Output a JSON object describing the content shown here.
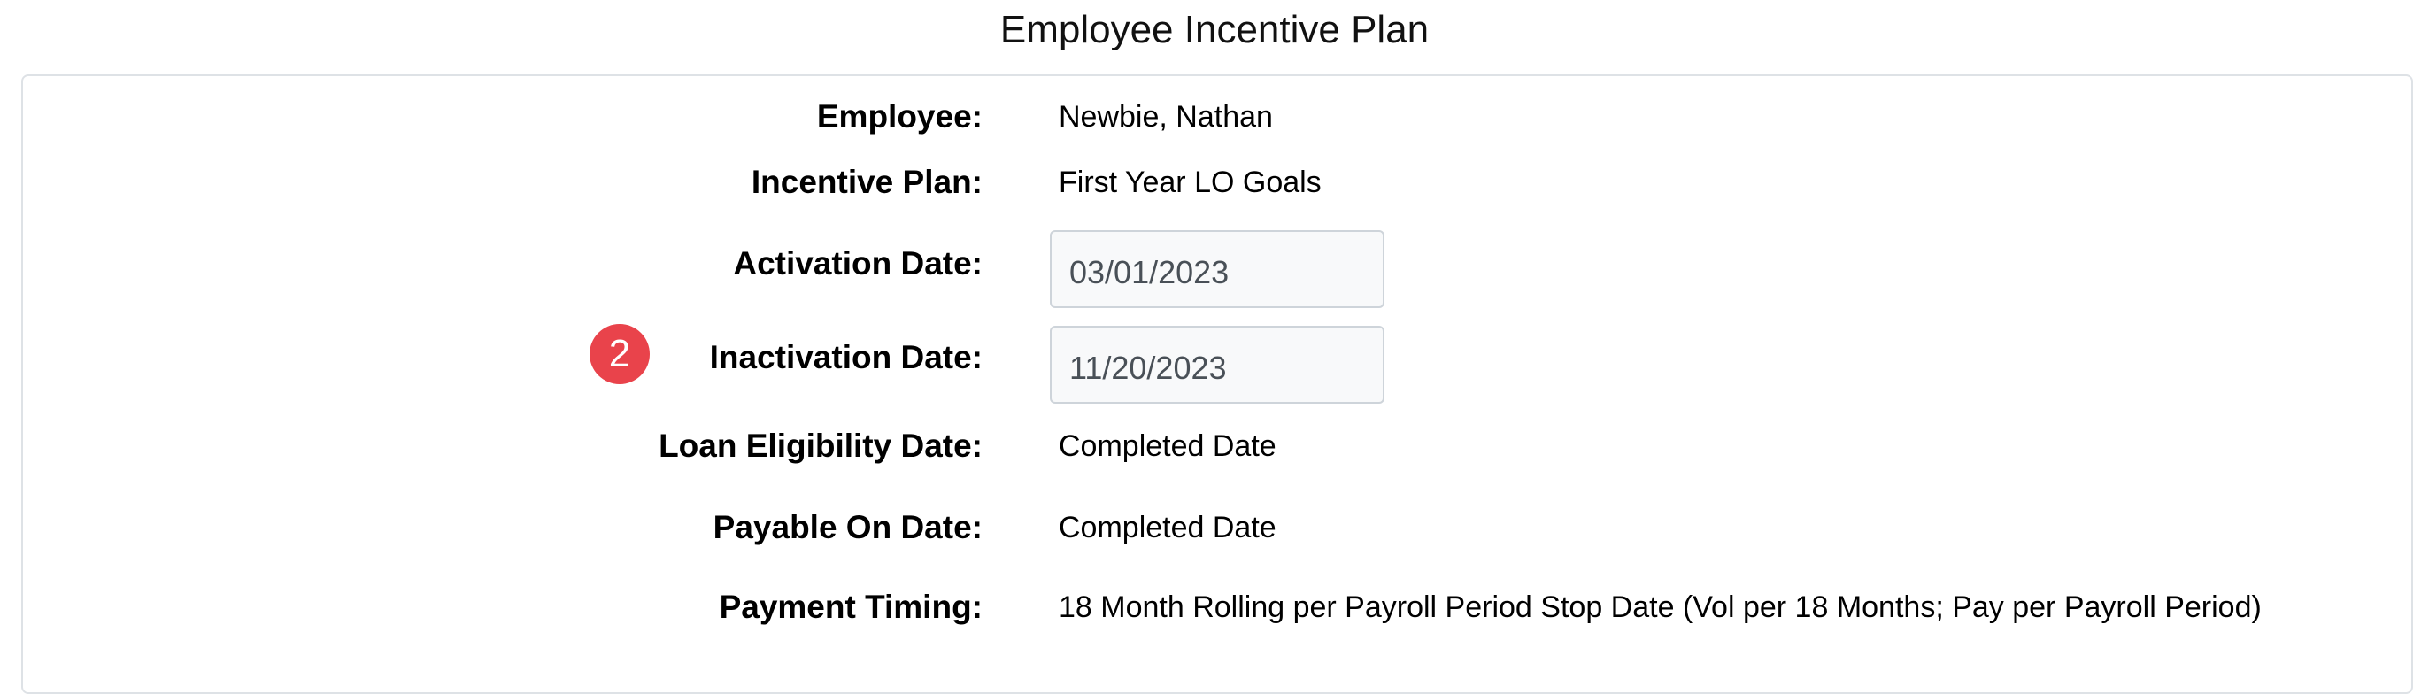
{
  "page": {
    "title": "Employee Incentive Plan"
  },
  "form": {
    "employee": {
      "label": "Employee:",
      "value": "Newbie, Nathan"
    },
    "incentive_plan": {
      "label": "Incentive Plan:",
      "value": "First Year LO Goals"
    },
    "activation_date": {
      "label": "Activation Date:",
      "value": "03/01/2023"
    },
    "inactivation_date": {
      "label": "Inactivation Date:",
      "value": "11/20/2023"
    },
    "loan_eligibility_date": {
      "label": "Loan Eligibility Date:",
      "value": "Completed Date"
    },
    "payable_on_date": {
      "label": "Payable On Date:",
      "value": "Completed Date"
    },
    "payment_timing": {
      "label": "Payment Timing:",
      "value": "18 Month Rolling per Payroll Period Stop Date (Vol per 18 Months; Pay per Payroll Period)"
    }
  },
  "annotation": {
    "step_badge": "2",
    "badge_color": "#e9434b"
  }
}
